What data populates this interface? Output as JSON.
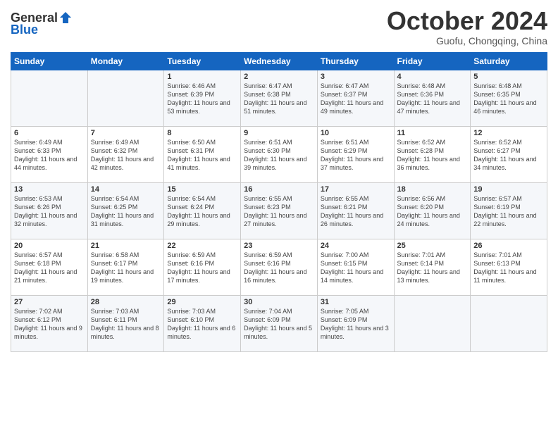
{
  "logo": {
    "general": "General",
    "blue": "Blue"
  },
  "header": {
    "month": "October 2024",
    "location": "Guofu, Chongqing, China"
  },
  "weekdays": [
    "Sunday",
    "Monday",
    "Tuesday",
    "Wednesday",
    "Thursday",
    "Friday",
    "Saturday"
  ],
  "weeks": [
    [
      {
        "day": "",
        "sunrise": "",
        "sunset": "",
        "daylight": ""
      },
      {
        "day": "",
        "sunrise": "",
        "sunset": "",
        "daylight": ""
      },
      {
        "day": "1",
        "sunrise": "Sunrise: 6:46 AM",
        "sunset": "Sunset: 6:39 PM",
        "daylight": "Daylight: 11 hours and 53 minutes."
      },
      {
        "day": "2",
        "sunrise": "Sunrise: 6:47 AM",
        "sunset": "Sunset: 6:38 PM",
        "daylight": "Daylight: 11 hours and 51 minutes."
      },
      {
        "day": "3",
        "sunrise": "Sunrise: 6:47 AM",
        "sunset": "Sunset: 6:37 PM",
        "daylight": "Daylight: 11 hours and 49 minutes."
      },
      {
        "day": "4",
        "sunrise": "Sunrise: 6:48 AM",
        "sunset": "Sunset: 6:36 PM",
        "daylight": "Daylight: 11 hours and 47 minutes."
      },
      {
        "day": "5",
        "sunrise": "Sunrise: 6:48 AM",
        "sunset": "Sunset: 6:35 PM",
        "daylight": "Daylight: 11 hours and 46 minutes."
      }
    ],
    [
      {
        "day": "6",
        "sunrise": "Sunrise: 6:49 AM",
        "sunset": "Sunset: 6:33 PM",
        "daylight": "Daylight: 11 hours and 44 minutes."
      },
      {
        "day": "7",
        "sunrise": "Sunrise: 6:49 AM",
        "sunset": "Sunset: 6:32 PM",
        "daylight": "Daylight: 11 hours and 42 minutes."
      },
      {
        "day": "8",
        "sunrise": "Sunrise: 6:50 AM",
        "sunset": "Sunset: 6:31 PM",
        "daylight": "Daylight: 11 hours and 41 minutes."
      },
      {
        "day": "9",
        "sunrise": "Sunrise: 6:51 AM",
        "sunset": "Sunset: 6:30 PM",
        "daylight": "Daylight: 11 hours and 39 minutes."
      },
      {
        "day": "10",
        "sunrise": "Sunrise: 6:51 AM",
        "sunset": "Sunset: 6:29 PM",
        "daylight": "Daylight: 11 hours and 37 minutes."
      },
      {
        "day": "11",
        "sunrise": "Sunrise: 6:52 AM",
        "sunset": "Sunset: 6:28 PM",
        "daylight": "Daylight: 11 hours and 36 minutes."
      },
      {
        "day": "12",
        "sunrise": "Sunrise: 6:52 AM",
        "sunset": "Sunset: 6:27 PM",
        "daylight": "Daylight: 11 hours and 34 minutes."
      }
    ],
    [
      {
        "day": "13",
        "sunrise": "Sunrise: 6:53 AM",
        "sunset": "Sunset: 6:26 PM",
        "daylight": "Daylight: 11 hours and 32 minutes."
      },
      {
        "day": "14",
        "sunrise": "Sunrise: 6:54 AM",
        "sunset": "Sunset: 6:25 PM",
        "daylight": "Daylight: 11 hours and 31 minutes."
      },
      {
        "day": "15",
        "sunrise": "Sunrise: 6:54 AM",
        "sunset": "Sunset: 6:24 PM",
        "daylight": "Daylight: 11 hours and 29 minutes."
      },
      {
        "day": "16",
        "sunrise": "Sunrise: 6:55 AM",
        "sunset": "Sunset: 6:23 PM",
        "daylight": "Daylight: 11 hours and 27 minutes."
      },
      {
        "day": "17",
        "sunrise": "Sunrise: 6:55 AM",
        "sunset": "Sunset: 6:21 PM",
        "daylight": "Daylight: 11 hours and 26 minutes."
      },
      {
        "day": "18",
        "sunrise": "Sunrise: 6:56 AM",
        "sunset": "Sunset: 6:20 PM",
        "daylight": "Daylight: 11 hours and 24 minutes."
      },
      {
        "day": "19",
        "sunrise": "Sunrise: 6:57 AM",
        "sunset": "Sunset: 6:19 PM",
        "daylight": "Daylight: 11 hours and 22 minutes."
      }
    ],
    [
      {
        "day": "20",
        "sunrise": "Sunrise: 6:57 AM",
        "sunset": "Sunset: 6:18 PM",
        "daylight": "Daylight: 11 hours and 21 minutes."
      },
      {
        "day": "21",
        "sunrise": "Sunrise: 6:58 AM",
        "sunset": "Sunset: 6:17 PM",
        "daylight": "Daylight: 11 hours and 19 minutes."
      },
      {
        "day": "22",
        "sunrise": "Sunrise: 6:59 AM",
        "sunset": "Sunset: 6:16 PM",
        "daylight": "Daylight: 11 hours and 17 minutes."
      },
      {
        "day": "23",
        "sunrise": "Sunrise: 6:59 AM",
        "sunset": "Sunset: 6:16 PM",
        "daylight": "Daylight: 11 hours and 16 minutes."
      },
      {
        "day": "24",
        "sunrise": "Sunrise: 7:00 AM",
        "sunset": "Sunset: 6:15 PM",
        "daylight": "Daylight: 11 hours and 14 minutes."
      },
      {
        "day": "25",
        "sunrise": "Sunrise: 7:01 AM",
        "sunset": "Sunset: 6:14 PM",
        "daylight": "Daylight: 11 hours and 13 minutes."
      },
      {
        "day": "26",
        "sunrise": "Sunrise: 7:01 AM",
        "sunset": "Sunset: 6:13 PM",
        "daylight": "Daylight: 11 hours and 11 minutes."
      }
    ],
    [
      {
        "day": "27",
        "sunrise": "Sunrise: 7:02 AM",
        "sunset": "Sunset: 6:12 PM",
        "daylight": "Daylight: 11 hours and 9 minutes."
      },
      {
        "day": "28",
        "sunrise": "Sunrise: 7:03 AM",
        "sunset": "Sunset: 6:11 PM",
        "daylight": "Daylight: 11 hours and 8 minutes."
      },
      {
        "day": "29",
        "sunrise": "Sunrise: 7:03 AM",
        "sunset": "Sunset: 6:10 PM",
        "daylight": "Daylight: 11 hours and 6 minutes."
      },
      {
        "day": "30",
        "sunrise": "Sunrise: 7:04 AM",
        "sunset": "Sunset: 6:09 PM",
        "daylight": "Daylight: 11 hours and 5 minutes."
      },
      {
        "day": "31",
        "sunrise": "Sunrise: 7:05 AM",
        "sunset": "Sunset: 6:09 PM",
        "daylight": "Daylight: 11 hours and 3 minutes."
      },
      {
        "day": "",
        "sunrise": "",
        "sunset": "",
        "daylight": ""
      },
      {
        "day": "",
        "sunrise": "",
        "sunset": "",
        "daylight": ""
      }
    ]
  ]
}
